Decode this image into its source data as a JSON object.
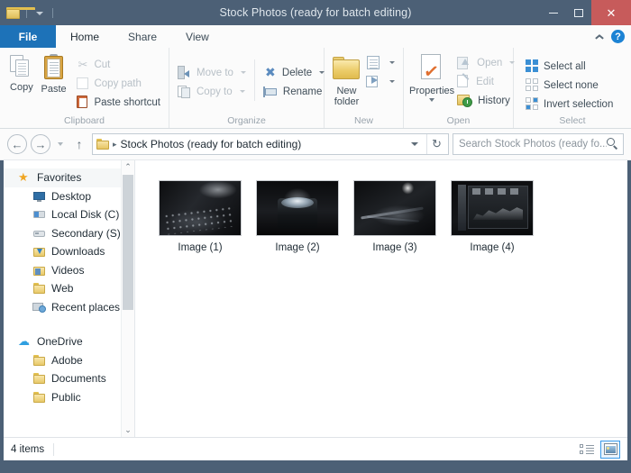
{
  "window": {
    "title": "Stock Photos (ready for batch editing)",
    "accent_titlebar": "#4c6076",
    "close_button_color": "#c75b5b",
    "quick_access": {
      "folder_icon": "folder-icon",
      "dropdown_icon": "chevron-down-icon"
    },
    "controls": {
      "minimize": "minimize-icon",
      "maximize": "maximize-icon",
      "close": "close-icon"
    }
  },
  "tabs": {
    "file_label": "File",
    "items": [
      {
        "label": "Home",
        "active": true
      },
      {
        "label": "Share",
        "active": false
      },
      {
        "label": "View",
        "active": false
      }
    ],
    "collapse_icon": "chevron-up-icon",
    "help_icon": "help-icon",
    "help_glyph": "?"
  },
  "ribbon": {
    "groups": [
      {
        "name": "Clipboard",
        "label": "Clipboard",
        "big_buttons": [
          {
            "label": "Copy",
            "icon": "copy-icon",
            "disabled": false
          },
          {
            "label": "Paste",
            "icon": "paste-icon",
            "disabled": false
          }
        ],
        "small_buttons": [
          {
            "label": "Cut",
            "icon": "scissors-icon",
            "disabled": true
          },
          {
            "label": "Copy path",
            "icon": "copy-path-icon",
            "disabled": true
          },
          {
            "label": "Paste shortcut",
            "icon": "paste-shortcut-icon",
            "disabled": false
          }
        ]
      },
      {
        "name": "Organize",
        "label": "Organize",
        "small_buttons": [
          {
            "label": "Move to",
            "icon": "move-to-icon",
            "disabled": true,
            "caret": true
          },
          {
            "label": "Copy to",
            "icon": "copy-to-icon",
            "disabled": true,
            "caret": true
          },
          {
            "label": "Delete",
            "icon": "delete-icon",
            "disabled": false,
            "caret": true
          },
          {
            "label": "Rename",
            "icon": "rename-icon",
            "disabled": false,
            "caret": false
          }
        ]
      },
      {
        "name": "New",
        "label": "New",
        "big_buttons": [
          {
            "label": "New\nfolder",
            "line1": "New",
            "line2": "folder",
            "icon": "new-folder-icon",
            "disabled": false
          }
        ],
        "small_buttons": [
          {
            "label": "",
            "icon": "new-item-icon",
            "disabled": false,
            "caret": true
          },
          {
            "label": "",
            "icon": "easy-access-icon",
            "disabled": false,
            "caret": true
          }
        ]
      },
      {
        "name": "Open",
        "label": "Open",
        "big_buttons": [
          {
            "label": "Properties",
            "icon": "properties-icon",
            "disabled": false,
            "caret": true
          }
        ],
        "small_buttons": [
          {
            "label": "Open",
            "icon": "open-icon",
            "disabled": true,
            "caret": true
          },
          {
            "label": "Edit",
            "icon": "edit-icon",
            "disabled": true,
            "caret": false
          },
          {
            "label": "History",
            "icon": "history-icon",
            "disabled": false,
            "caret": false
          }
        ]
      },
      {
        "name": "Select",
        "label": "Select",
        "small_buttons": [
          {
            "label": "Select all",
            "icon": "select-all-icon",
            "disabled": false
          },
          {
            "label": "Select none",
            "icon": "select-none-icon",
            "disabled": false
          },
          {
            "label": "Invert selection",
            "icon": "invert-selection-icon",
            "disabled": false
          }
        ]
      }
    ]
  },
  "address_bar": {
    "back_icon": "back-arrow-icon",
    "back_glyph": "←",
    "forward_icon": "forward-arrow-icon",
    "forward_glyph": "→",
    "history_icon": "chevron-down-icon",
    "up_icon": "up-arrow-icon",
    "up_glyph": "↑",
    "folder_icon": "folder-icon",
    "separator_glyph": "▸",
    "path_text": "Stock Photos (ready for batch editing)",
    "dropdown_icon": "chevron-down-icon",
    "refresh_icon": "refresh-icon",
    "refresh_glyph": "↻"
  },
  "search": {
    "placeholder": "Search Stock Photos (ready fo...",
    "icon": "search-icon"
  },
  "navigation_pane": {
    "sections": [
      {
        "head": {
          "label": "Favorites",
          "icon": "star-icon"
        },
        "items": [
          {
            "label": "Desktop",
            "icon": "desktop-icon"
          },
          {
            "label": "Local Disk (C)",
            "icon": "hard-drive-icon"
          },
          {
            "label": "Secondary (S)",
            "icon": "drive-icon"
          },
          {
            "label": "Downloads",
            "icon": "downloads-folder-icon"
          },
          {
            "label": "Videos",
            "icon": "videos-folder-icon"
          },
          {
            "label": "Web",
            "icon": "folder-icon"
          },
          {
            "label": "Recent places",
            "icon": "recent-places-icon"
          }
        ]
      },
      {
        "head": {
          "label": "OneDrive",
          "icon": "cloud-icon"
        },
        "items": [
          {
            "label": "Adobe",
            "icon": "folder-icon"
          },
          {
            "label": "Documents",
            "icon": "folder-icon"
          },
          {
            "label": "Public",
            "icon": "folder-icon"
          }
        ]
      }
    ],
    "scrollbar": {
      "up_glyph": "⌃",
      "down_glyph": "⌄"
    }
  },
  "content": {
    "files": [
      {
        "label": "Image (1)",
        "thumbnail": "dark-keyboard-photo"
      },
      {
        "label": "Image (2)",
        "thumbnail": "camera-lens-photo"
      },
      {
        "label": "Image (3)",
        "thumbnail": "cables-desk-photo"
      },
      {
        "label": "Image (4)",
        "thumbnail": "monitor-chart-photo"
      }
    ]
  },
  "status_bar": {
    "item_count": "4 items",
    "views": [
      {
        "name": "details-view",
        "icon": "details-view-icon",
        "active": false
      },
      {
        "name": "large-icons-view",
        "icon": "large-icons-view-icon",
        "active": true
      }
    ]
  }
}
